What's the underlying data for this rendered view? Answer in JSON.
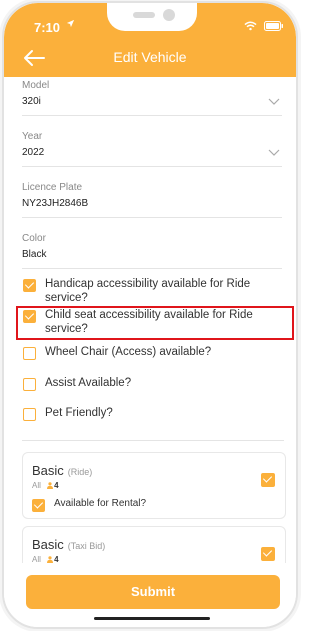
{
  "status_bar": {
    "time": "7:10"
  },
  "header": {
    "title": "Edit Vehicle"
  },
  "fields": {
    "model": {
      "label": "Model",
      "value": "320i"
    },
    "year": {
      "label": "Year",
      "value": "2022"
    },
    "licence_plate": {
      "label": "Licence Plate",
      "value": "NY23JH2846B"
    },
    "color": {
      "label": "Color",
      "value": "Black"
    }
  },
  "options": [
    {
      "label": "Handicap accessibility available for Ride service?",
      "checked": true
    },
    {
      "label": "Child seat accessibility available for Ride service?",
      "checked": true
    },
    {
      "label": "Wheel Chair (Access) available?",
      "checked": false
    },
    {
      "label": "Assist Available?",
      "checked": false
    },
    {
      "label": "Pet Friendly?",
      "checked": false
    }
  ],
  "services": [
    {
      "name": "Basic",
      "type": "(Ride)",
      "scope": "All",
      "seats": "4",
      "checked": true,
      "rental_label": "Available for Rental?",
      "rental_checked": true
    },
    {
      "name": "Basic",
      "type": "(Taxi Bid)",
      "scope": "All",
      "seats": "4",
      "checked": true
    }
  ],
  "submit_label": "Submit",
  "colors": {
    "accent": "#fbb03b",
    "highlight": "#e0151b"
  }
}
